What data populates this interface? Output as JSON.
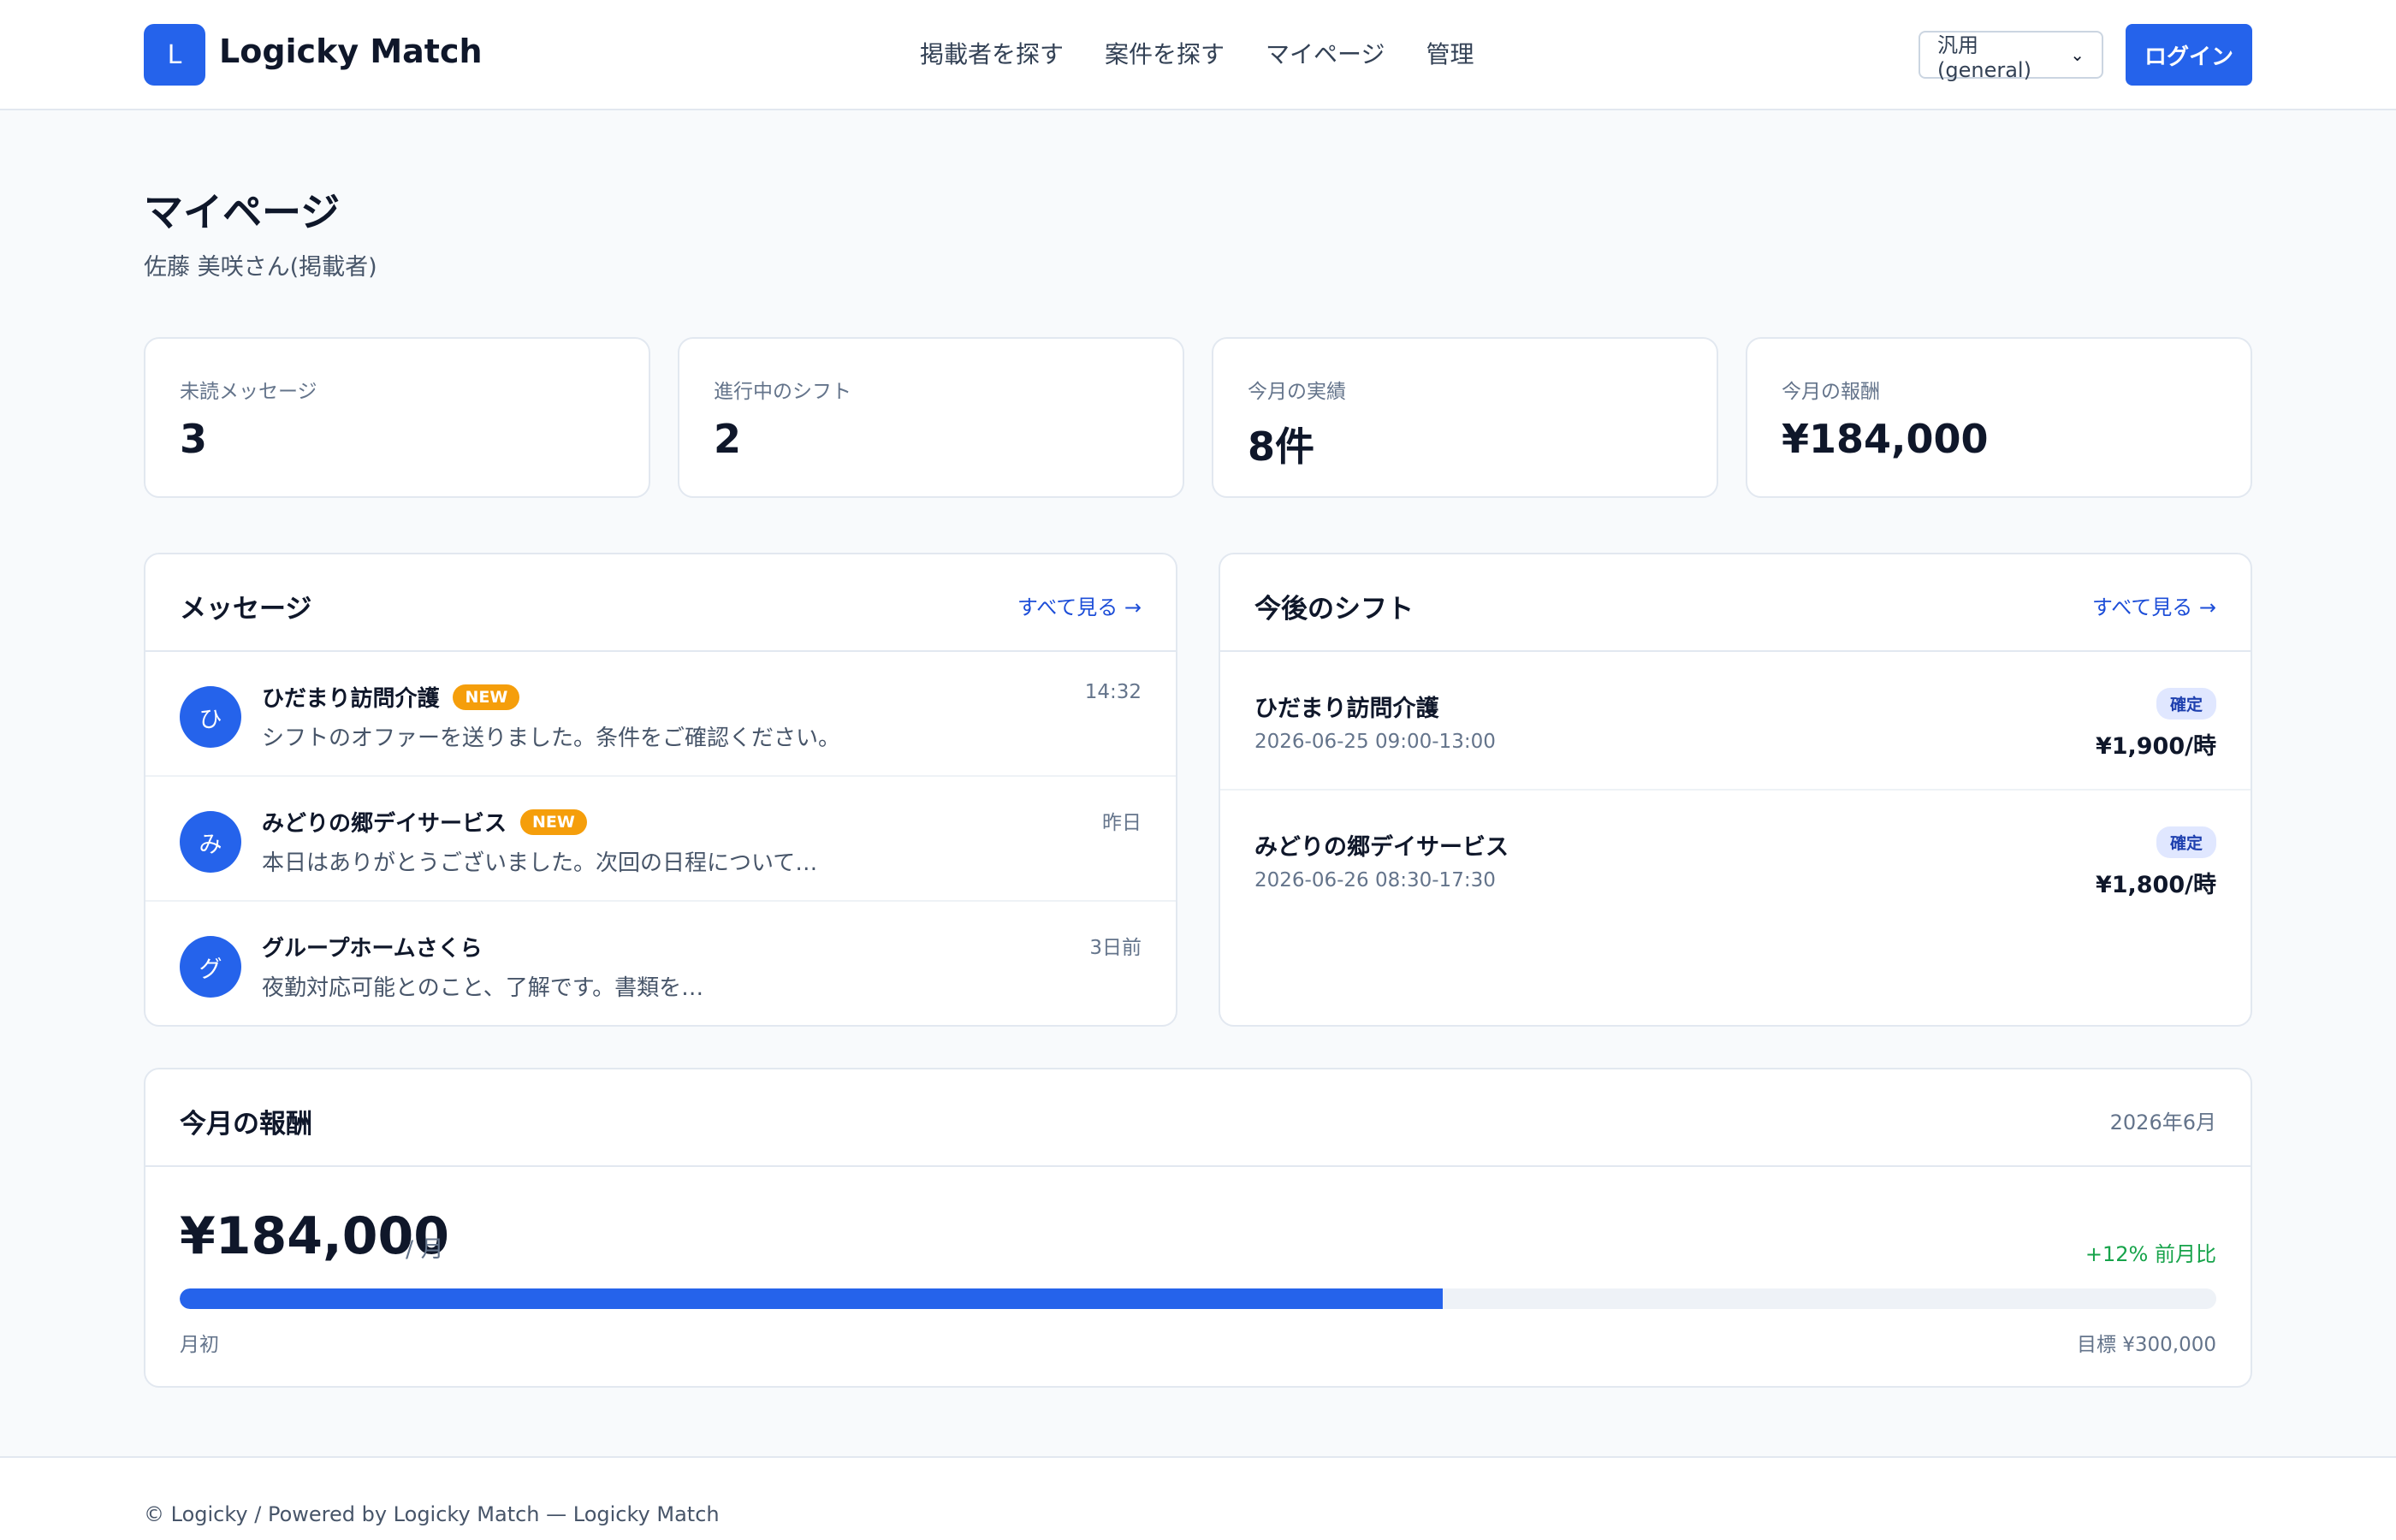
{
  "header": {
    "logo_letter": "L",
    "brand": "Logicky Match",
    "nav": [
      "掲載者を探す",
      "案件を探す",
      "マイページ",
      "管理"
    ],
    "role_select": "汎用(general)",
    "login": "ログイン"
  },
  "page": {
    "title": "マイページ",
    "subtitle": "佐藤 美咲さん(掲載者)"
  },
  "stats": [
    {
      "label": "未読メッセージ",
      "value": "3"
    },
    {
      "label": "進行中のシフト",
      "value": "2"
    },
    {
      "label": "今月の実績",
      "value": "8件"
    },
    {
      "label": "今月の報酬",
      "value": "¥184,000"
    }
  ],
  "messages": {
    "title": "メッセージ",
    "see_all": "すべて見る →",
    "items": [
      {
        "avatar": "ひ",
        "name": "ひだまり訪問介護",
        "badge": "NEW",
        "text": "シフトのオファーを送りました。条件をご確認ください。",
        "time": "14:32"
      },
      {
        "avatar": "み",
        "name": "みどりの郷デイサービス",
        "badge": "NEW",
        "text": "本日はありがとうございました。次回の日程について…",
        "time": "昨日"
      },
      {
        "avatar": "グ",
        "name": "グループホームさくら",
        "badge": "",
        "text": "夜勤対応可能とのこと、了解です。書類を…",
        "time": "3日前"
      }
    ]
  },
  "shifts": {
    "title": "今後のシフト",
    "see_all": "すべて見る →",
    "items": [
      {
        "name": "ひだまり訪問介護",
        "time": "2026-06-25 09:00-13:00",
        "status": "確定",
        "rate": "¥1,900/時"
      },
      {
        "name": "みどりの郷デイサービス",
        "time": "2026-06-26 08:30-17:30",
        "status": "確定",
        "rate": "¥1,800/時"
      }
    ]
  },
  "earnings": {
    "title": "今月の報酬",
    "month": "2026年6月",
    "amount": "¥184,000",
    "unit": "/ 月",
    "change": "+12% 前月比",
    "progress": 0.62,
    "start_label": "月初",
    "goal_label": "目標 ¥300,000"
  },
  "footer": {
    "text": "© Logicky / Powered by Logicky Match — Logicky Match"
  },
  "colors": {
    "accent": "#2563eb",
    "badge_new": "#f59e0b",
    "positive": "#16a34a"
  }
}
